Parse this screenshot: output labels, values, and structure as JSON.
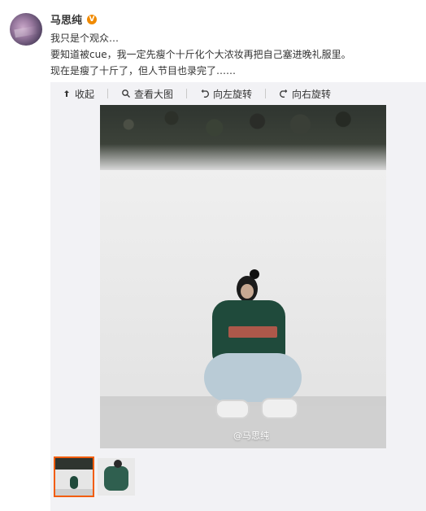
{
  "post": {
    "username": "马思纯",
    "verified_badge": "V",
    "lines": [
      "我只是个观众…",
      "要知道被cue，我一定先瘦个十斤化个大浓妆再把自己塞进晚礼服里。",
      "现在是瘦了十斤了，但人节目也录完了……"
    ]
  },
  "media": {
    "toolbar": {
      "collapse": "收起",
      "view_large": "查看大图",
      "rotate_left": "向左旋转",
      "rotate_right": "向右旋转"
    },
    "watermark": "@马思纯",
    "thumbnails": [
      {
        "selected": true
      },
      {
        "selected": false
      }
    ],
    "colors": {
      "panel_bg": "#f2f2f5",
      "accent_orange": "#f25c05",
      "badge_orange": "#f08a00"
    }
  }
}
